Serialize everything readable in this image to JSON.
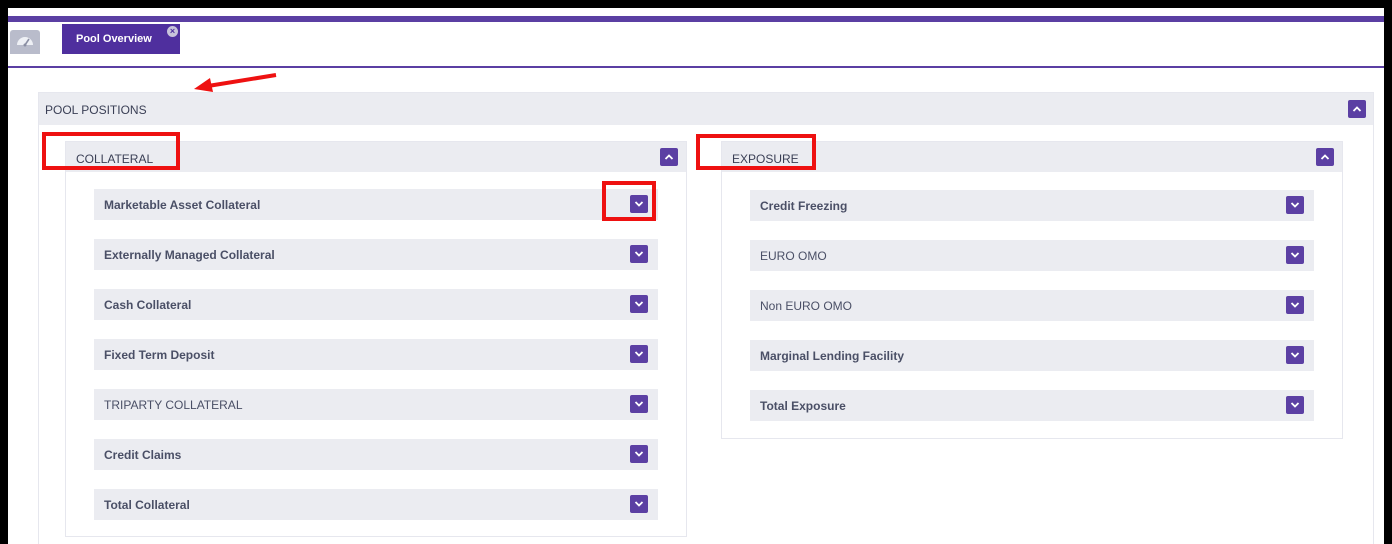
{
  "tabs": {
    "home_icon": "dashboard-icon",
    "active_tab_label": "Pool Overview",
    "close_icon": "×"
  },
  "pool": {
    "title": "POOL POSITIONS"
  },
  "collateral": {
    "title": "COLLATERAL",
    "items": [
      {
        "label": "Marketable Asset Collateral"
      },
      {
        "label": "Externally Managed Collateral"
      },
      {
        "label": "Cash Collateral"
      },
      {
        "label": "Fixed Term Deposit"
      },
      {
        "label": "TRIPARTY COLLATERAL"
      },
      {
        "label": "Credit Claims"
      },
      {
        "label": "Total Collateral"
      }
    ]
  },
  "exposure": {
    "title": "EXPOSURE",
    "items": [
      {
        "label": "Credit Freezing"
      },
      {
        "label": "EURO OMO"
      },
      {
        "label": "Non EURO OMO"
      },
      {
        "label": "Marginal Lending Facility"
      },
      {
        "label": "Total Exposure"
      }
    ]
  },
  "colors": {
    "accent": "#5b3fa3",
    "highlight": "#ee1111",
    "header_bg": "#ebecf1"
  }
}
